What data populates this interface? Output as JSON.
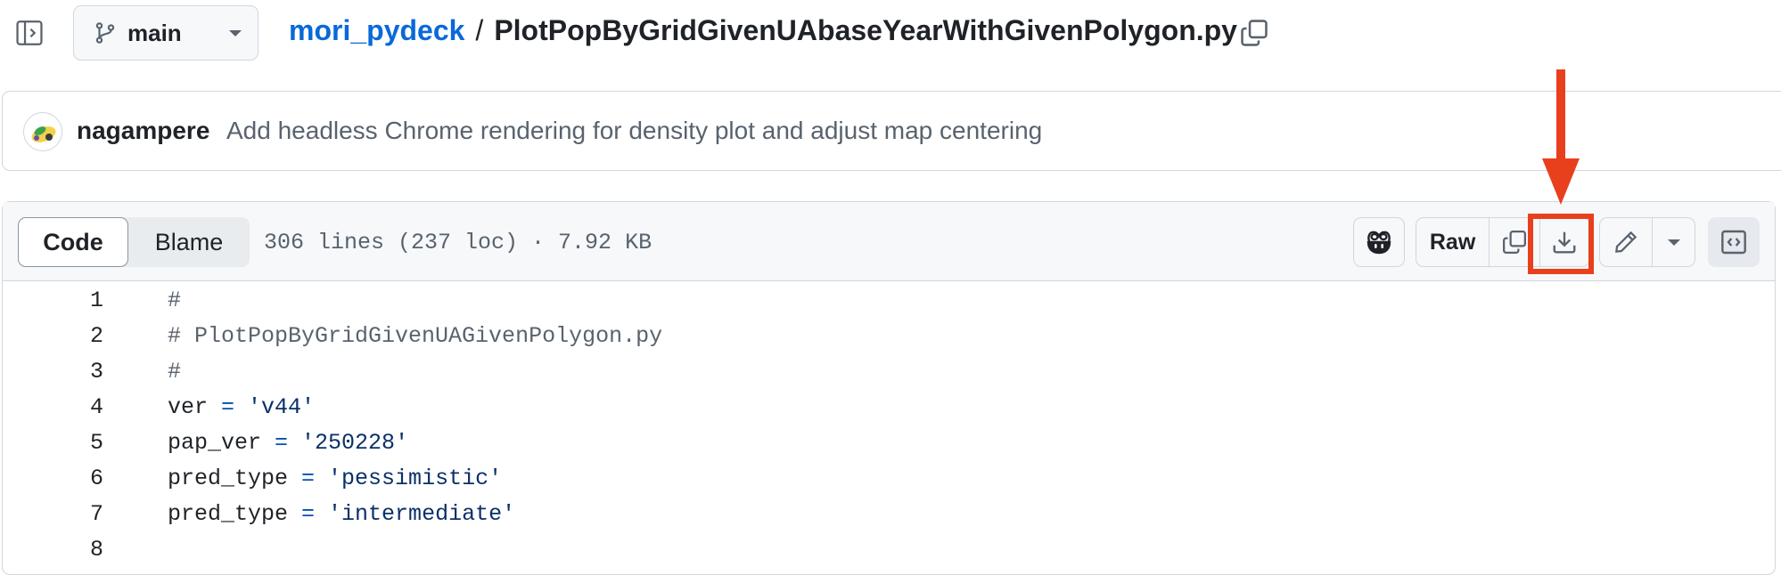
{
  "header": {
    "branch": "main",
    "repo": "mori_pydeck",
    "separator": "/",
    "filename": "PlotPopByGridGivenUAbaseYearWithGivenPolygon.py"
  },
  "commit": {
    "author": "nagampere",
    "message": "Add headless Chrome rendering for density plot and adjust map centering"
  },
  "file_header": {
    "tabs": [
      "Code",
      "Blame"
    ],
    "active_tab": "Code",
    "info": "306 lines (237 loc) · 7.92 KB",
    "raw_label": "Raw"
  },
  "icons": {
    "sidebar": "sidebar-collapse-icon",
    "branch": "git-branch-icon",
    "copy": "copy-icon",
    "copilot": "copilot-icon",
    "download": "download-icon",
    "edit": "pencil-icon",
    "symbols": "code-symbols-icon"
  },
  "colors": {
    "link": "#0969da",
    "annotation": "#e8401c",
    "string": "#0a3069",
    "operator": "#0550ae"
  },
  "code": [
    {
      "n": "1",
      "parts": [
        {
          "t": "#",
          "k": "comment"
        }
      ]
    },
    {
      "n": "2",
      "parts": [
        {
          "t": "# PlotPopByGridGivenUAGivenPolygon.py",
          "k": "comment"
        }
      ]
    },
    {
      "n": "3",
      "parts": [
        {
          "t": "#",
          "k": "comment"
        }
      ]
    },
    {
      "n": "4",
      "parts": [
        {
          "t": "ver",
          "k": "plain"
        },
        {
          "t": " = ",
          "k": "op"
        },
        {
          "t": "'v44'",
          "k": "str"
        }
      ]
    },
    {
      "n": "5",
      "parts": [
        {
          "t": "pap_ver",
          "k": "plain"
        },
        {
          "t": " = ",
          "k": "op"
        },
        {
          "t": "'250228'",
          "k": "str"
        }
      ]
    },
    {
      "n": "6",
      "parts": [
        {
          "t": "pred_type",
          "k": "plain"
        },
        {
          "t": " = ",
          "k": "op"
        },
        {
          "t": "'pessimistic'",
          "k": "str"
        }
      ]
    },
    {
      "n": "7",
      "parts": [
        {
          "t": "pred_type",
          "k": "plain"
        },
        {
          "t": " = ",
          "k": "op"
        },
        {
          "t": "'intermediate'",
          "k": "str"
        }
      ]
    },
    {
      "n": "8",
      "parts": []
    }
  ]
}
